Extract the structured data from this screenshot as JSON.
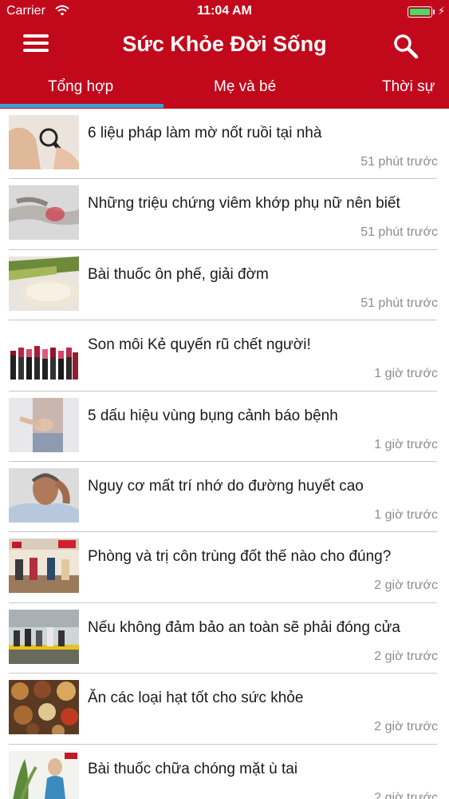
{
  "status_bar": {
    "carrier": "Carrier",
    "time": "11:04 AM"
  },
  "header": {
    "title": "Sức Khỏe Đời Sống",
    "menu_icon": "hamburger-menu-icon",
    "search_icon": "search-icon"
  },
  "colors": {
    "brand": "#c2091c",
    "tab_indicator": "#3ba0d9",
    "meta_text": "#8c8c8c"
  },
  "tabs": [
    {
      "label": "Tổng hợp",
      "selected": true
    },
    {
      "label": "Mẹ và bé",
      "selected": false
    },
    {
      "label": "Thời sự",
      "selected": false
    }
  ],
  "articles": [
    {
      "title": "6 liệu pháp làm mờ nốt ruồi tại nhà",
      "time": "51 phút trước"
    },
    {
      "title": "Những triệu chứng viêm khớp phụ nữ nên biết",
      "time": "51 phút trước"
    },
    {
      "title": "Bài thuốc ôn phế, giải đờm",
      "time": "51 phút trước"
    },
    {
      "title": "Son môi Kẻ quyến rũ chết người!",
      "time": "1 giờ trước"
    },
    {
      "title": "5 dấu hiệu vùng bụng cảnh báo bệnh",
      "time": "1 giờ trước"
    },
    {
      "title": "Nguy cơ mất trí nhớ do đường huyết cao",
      "time": "1 giờ trước"
    },
    {
      "title": "Phòng và trị côn trùng đốt thế nào cho đúng?",
      "time": "2 giờ trước"
    },
    {
      "title": "Nếu không đảm bảo an toàn sẽ phải đóng cửa",
      "time": "2 giờ trước"
    },
    {
      "title": "Ăn các loại hạt tốt cho sức khỏe",
      "time": "2 giờ trước"
    },
    {
      "title": "Bài thuốc chữa chóng mặt ù tai",
      "time": "2 giờ trước"
    }
  ]
}
